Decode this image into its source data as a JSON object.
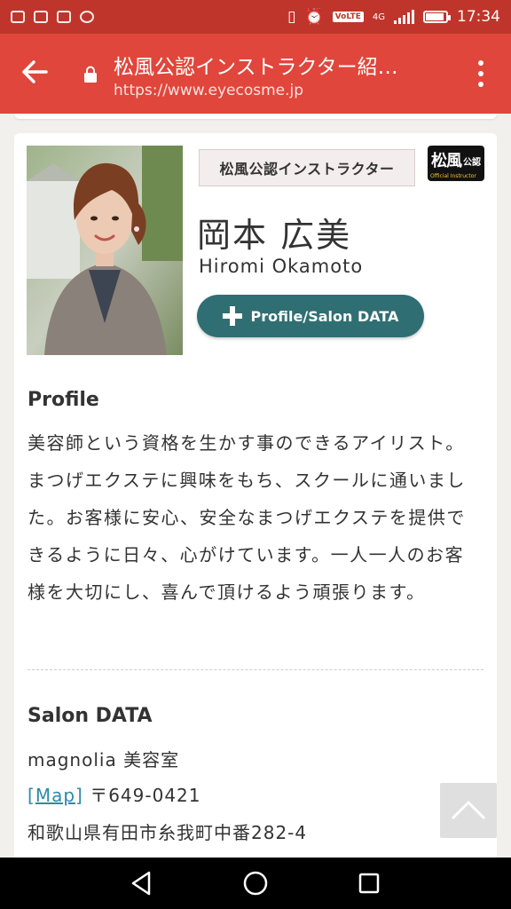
{
  "status_bar": {
    "time": "17:34",
    "volte": "VoLTE",
    "network": "4G",
    "battery_level": 0.85
  },
  "toolbar": {
    "title": "松風公認インストラクター紹…",
    "url": "https://www.eyecosme.jp"
  },
  "instructor": {
    "tag": "松風公認インストラクター",
    "logo_main": "松風",
    "logo_sub": "公認",
    "logo_caption": "Official Instructor",
    "name_jp": "岡本 広美",
    "name_en": "Hiromi Okamoto",
    "button_label": "Profile/Salon DATA"
  },
  "profile": {
    "title": "Profile",
    "text": "美容師という資格を生かす事のできるアイリスト。まつげエクステに興味をもち、スクールに通いました。お客様に安心、安全なまつげエクステを提供できるように日々、心がけています。一人一人のお客様を大切にし、喜んで頂けるよう頑張ります。"
  },
  "salon": {
    "title": "Salon DATA",
    "name": "magnolia 美容室",
    "map_open": "[",
    "map_label": "Map",
    "map_close": "]",
    "zip": "〒649-0421",
    "address": "和歌山県有田市糸我町中番282-4"
  },
  "colors": {
    "status_bar": "#c0352b",
    "toolbar": "#e0463b",
    "button": "#2f6f73",
    "link": "#2a8ba8"
  }
}
